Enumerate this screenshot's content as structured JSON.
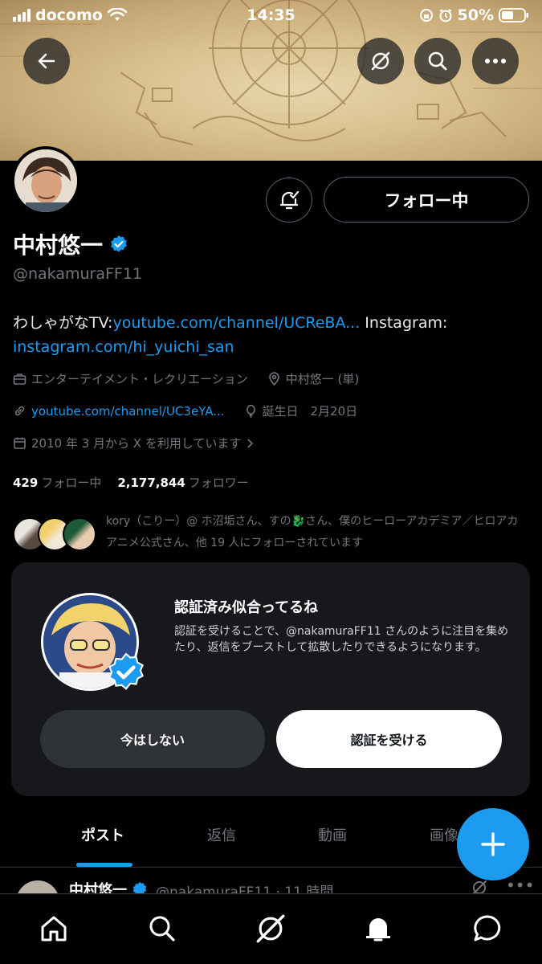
{
  "status_bar": {
    "carrier": "docomo",
    "time": "14:35",
    "battery": "50%"
  },
  "top_bar": {
    "back_icon": "back-arrow-icon",
    "grok_icon": "grok-icon",
    "search_icon": "search-icon",
    "more_icon": "more-icon"
  },
  "profile": {
    "display_name": "中村悠一",
    "handle": "@nakamuraFF11",
    "follow_button": "フォロー中",
    "bio_text_1": "わしゃがなTV:",
    "bio_link_1": "youtube.com/channel/UCReBA...",
    "bio_text_2": " Instagram:",
    "bio_link_2": "instagram.com/hi_yuichi_san",
    "category": "エンターテイメント・レクリエーション",
    "location": "中村悠一 (単)",
    "website": "youtube.com/channel/UC3eYA...",
    "birthday": "誕生日　2月20日",
    "joined": "2010 年 3 月から X を利用しています",
    "following_count": "429",
    "following_label": "フォロー中",
    "followers_count": "2,177,844",
    "followers_label": "フォロワー",
    "followed_by": "kory（こりー）@ ホ沼垢さん、すの🐉さん、僕のヒーローアカデミア／ヒロアカ アニメ公式さん、他 19 人にフォローされています"
  },
  "promo_card": {
    "title": "認証済み似合ってるね",
    "body": "認証を受けることで、@nakamuraFF11 さんのように注目を集めたり、返信をブーストして拡散したりできるようになります。",
    "dismiss_button": "今はしない",
    "verify_button": "認証を受ける"
  },
  "tabs": [
    {
      "label": "ポスト",
      "active": true
    },
    {
      "label": "返信",
      "active": false
    },
    {
      "label": "動画",
      "active": false
    },
    {
      "label": "画像",
      "active": false
    }
  ],
  "post_preview": {
    "name": "中村悠一",
    "handle_time": "@nakamuraFF11 · 11 時間"
  },
  "bottom_nav": [
    "home-icon",
    "search-icon",
    "grok-icon",
    "notifications-icon",
    "messages-icon"
  ],
  "colors": {
    "accent": "#1d9bf0",
    "background": "#000000",
    "muted": "#71767b"
  }
}
